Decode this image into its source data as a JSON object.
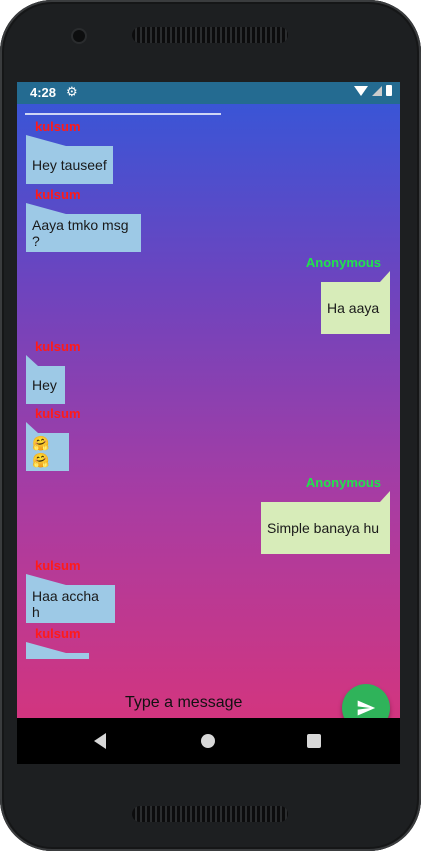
{
  "status_bar": {
    "time": "4:28",
    "settings_icon": "gear-icon",
    "wifi_icon": "wifi-icon",
    "signal_icon": "signal-icon",
    "battery_icon": "battery-icon"
  },
  "messages": [
    {
      "sender": "kulsum",
      "text": "Hey tauseef",
      "side": "left"
    },
    {
      "sender": "kulsum",
      "text": "Aaya tmko msg ?",
      "side": "left"
    },
    {
      "sender": "Anonymous",
      "text": "Ha aaya",
      "side": "right"
    },
    {
      "sender": "kulsum",
      "text": "Hey",
      "side": "left"
    },
    {
      "sender": "kulsum",
      "text": "🤗🤗",
      "side": "left"
    },
    {
      "sender": "Anonymous",
      "text": "Simple banaya hu",
      "side": "right"
    },
    {
      "sender": "kulsum",
      "text": "Haa accha h",
      "side": "left"
    },
    {
      "sender": "kulsum",
      "text": "",
      "side": "left"
    }
  ],
  "composer": {
    "placeholder": "Type a message",
    "send_icon": "send-icon"
  },
  "colors": {
    "sender_left": "#ff1a1a",
    "sender_right": "#21e34a",
    "bubble_left": "#9dc9e6",
    "bubble_right": "#d7ecb9",
    "send_button": "#2fb35a",
    "status_bar": "#246b91"
  },
  "nav_bar": {
    "back_icon": "back-icon",
    "home_icon": "home-icon",
    "recents_icon": "recents-icon"
  }
}
